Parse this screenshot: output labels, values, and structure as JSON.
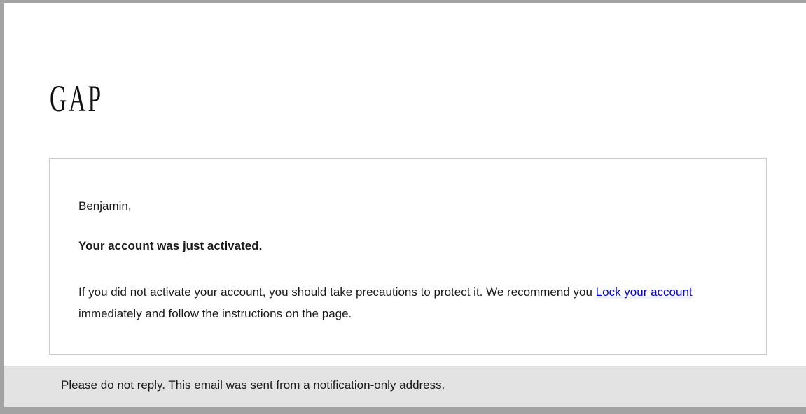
{
  "header": {
    "logo_text": "GAP"
  },
  "message": {
    "greeting": "Benjamin,",
    "headline": "Your account was just activated.",
    "body_before_link": "If you did not activate your account, you should take precautions to protect it. We recommend you ",
    "link_text": "Lock your account",
    "body_after_link": " immediately and follow the instructions on the page."
  },
  "footer": {
    "notice": "Please do not reply. This email was sent from a notification-only address."
  },
  "colors": {
    "frame_border": "#a3a3a3",
    "footer_background": "#e3e3e3",
    "link": "#0000ee"
  }
}
